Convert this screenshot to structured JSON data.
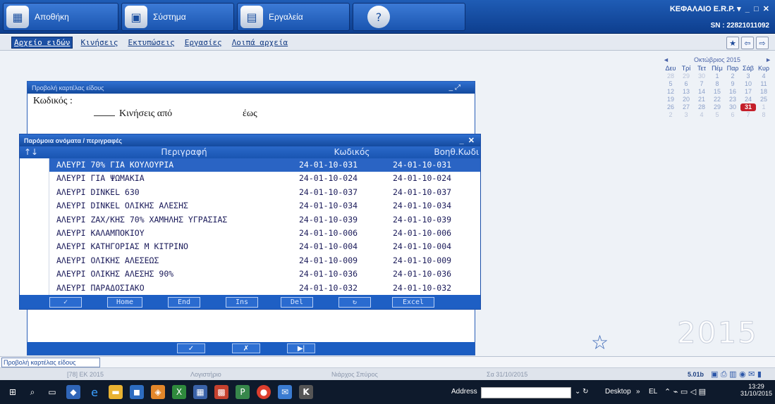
{
  "toolbar": {
    "buttons": [
      {
        "label": "Αποθήκη",
        "icon": "warehouse-icon"
      },
      {
        "label": "Σύστημα",
        "icon": "system-icon"
      },
      {
        "label": "Εργαλεία",
        "icon": "tools-icon"
      },
      {
        "label": "",
        "icon": "help-icon"
      }
    ],
    "company": "ΚΕΦΑΛΑΙΟ E.R.P.",
    "serial": "SN : 22821011092"
  },
  "menu": {
    "items": [
      "Αρχείο ειδών",
      "Κινήσεις",
      "Εκτυπώσεις",
      "Εργασίες",
      "Λοιπά αρχεία"
    ],
    "active_index": 0
  },
  "calendar": {
    "title": "Οκτώβριος 2015",
    "days": [
      "Δευ",
      "Τρί",
      "Τετ",
      "Πέμ",
      "Παρ",
      "Σάβ",
      "Κυρ"
    ],
    "weeks": [
      [
        "28",
        "29",
        "30",
        "1",
        "2",
        "3",
        "4"
      ],
      [
        "5",
        "6",
        "7",
        "8",
        "9",
        "10",
        "11"
      ],
      [
        "12",
        "13",
        "14",
        "15",
        "16",
        "17",
        "18"
      ],
      [
        "19",
        "20",
        "21",
        "22",
        "23",
        "24",
        "25"
      ],
      [
        "26",
        "27",
        "28",
        "29",
        "30",
        "31",
        "1"
      ],
      [
        "2",
        "3",
        "4",
        "5",
        "6",
        "7",
        "8"
      ]
    ],
    "today": "31"
  },
  "year_watermark": "2015",
  "card_window": {
    "title": "Προβολή καρτέλας είδους",
    "code_label": "Κωδικός :",
    "movements_from": "Κινήσεις από",
    "movements_to": "έως",
    "buttons": [
      "✓",
      "✗",
      "▶|"
    ]
  },
  "similar_dialog": {
    "title": "Παρόμοια ονόματα / περιγραφές",
    "sort_icon": "↑↓",
    "columns": [
      "Περιγραφή",
      "Κωδικός",
      "Βοηθ.Κωδι"
    ],
    "rows": [
      {
        "desc": "ΑΛΕΥΡΙ 70% ΓΙΑ ΚΟΥΛΟΥΡΙΑ",
        "code": "24-01-10-031",
        "aux": "24-01-10-031"
      },
      {
        "desc": "ΑΛΕΥΡΙ ΓΙΑ ΨΩΜΑΚΙΑ",
        "code": "24-01-10-024",
        "aux": "24-01-10-024"
      },
      {
        "desc": "ΑΛΕΥΡΙ DINKEL 630",
        "code": "24-01-10-037",
        "aux": "24-01-10-037"
      },
      {
        "desc": "ΑΛΕΥΡΙ DINKEL ΟΛΙΚΗΣ ΑΛΕΣΗΣ",
        "code": "24-01-10-034",
        "aux": "24-01-10-034"
      },
      {
        "desc": "ΑΛΕΥΡΙ ΖΑΧ/ΚΗΣ 70% ΧΑΜΗΛΗΣ ΥΓΡΑΣΙΑΣ",
        "code": "24-01-10-039",
        "aux": "24-01-10-039"
      },
      {
        "desc": "ΑΛΕΥΡΙ ΚΑΛΑΜΠΟΚΙΟΥ",
        "code": "24-01-10-006",
        "aux": "24-01-10-006"
      },
      {
        "desc": "ΑΛΕΥΡΙ ΚΑΤΗΓΟΡΙΑΣ Μ  ΚΙΤΡΙΝΟ",
        "code": "24-01-10-004",
        "aux": "24-01-10-004"
      },
      {
        "desc": "ΑΛΕΥΡΙ ΟΛΙΚΗΣ ΑΛΕΣΕΩΣ",
        "code": "24-01-10-009",
        "aux": "24-01-10-009"
      },
      {
        "desc": "ΑΛΕΥΡΙ ΟΛΙΚΗΣ ΑΛΕΣΗΣ 90%",
        "code": "24-01-10-036",
        "aux": "24-01-10-036"
      },
      {
        "desc": "ΑΛΕΥΡΙ ΠΑΡΑΔΟΣΙΑΚΟ",
        "code": "24-01-10-032",
        "aux": "24-01-10-032"
      }
    ],
    "selected_index": 0,
    "buttons": [
      "✓",
      "Home",
      "End",
      "Ins",
      "Del",
      "↻",
      "Excel"
    ]
  },
  "status": {
    "tab": "Προβολή καρτέλας είδους",
    "company": "[78] EK 2015",
    "module": "Λογιστήριο",
    "user": "Νιάρχος Σπύρος",
    "date": "Σα 31/10/2015",
    "version": "5.01b"
  },
  "taskbar": {
    "address_label": "Address",
    "desktop_label": "Desktop",
    "lang": "EL",
    "time": "13:29",
    "date": "31/10/2015"
  }
}
